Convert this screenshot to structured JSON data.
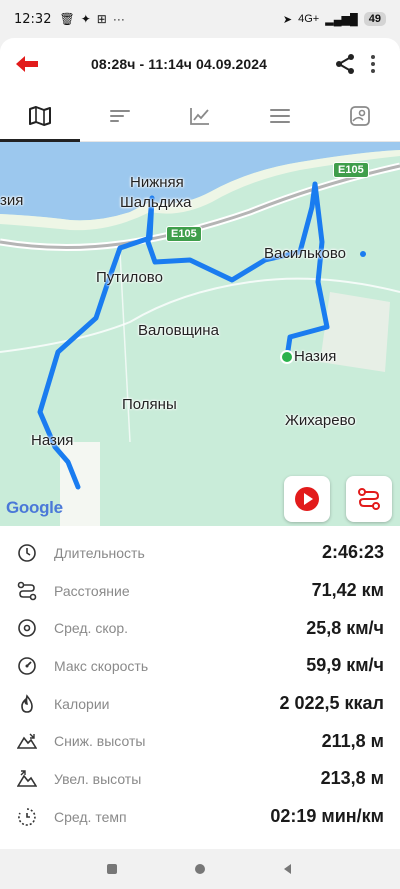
{
  "status_bar": {
    "time": "12:32",
    "network": "4G+",
    "battery": "49"
  },
  "header": {
    "title": "08:28ч - 11:14ч   04.09.2024"
  },
  "tabs": [
    {
      "icon": "map-icon",
      "active": true
    },
    {
      "icon": "laps-icon",
      "active": false
    },
    {
      "icon": "chart-icon",
      "active": false
    },
    {
      "icon": "list-icon",
      "active": false
    },
    {
      "icon": "photo-map-icon",
      "active": false
    }
  ],
  "map": {
    "labels": {
      "nizhnyaya": "Нижняя",
      "shaldikha": "Шальдиха",
      "putilovo": "Путилово",
      "valovshchina": "Валовщина",
      "polyany": "Поляны",
      "nazia_left": "Назия",
      "nazia_right": "Назия",
      "vasilkovo": "Васильково",
      "zhikharevo": "Жихарево",
      "edge_left": "зия"
    },
    "road_shields": [
      "E105",
      "E105"
    ],
    "attribution": "Google",
    "route_color": "#1a7cf0"
  },
  "stats": [
    {
      "icon": "duration-icon",
      "label": "Длительность",
      "value": "2:46:23"
    },
    {
      "icon": "distance-icon",
      "label": "Расстояние",
      "value": "71,42 км"
    },
    {
      "icon": "avg-speed-icon",
      "label": "Сред. скор.",
      "value": "25,8 км/ч"
    },
    {
      "icon": "max-speed-icon",
      "label": "Макс скорость",
      "value": "59,9 км/ч"
    },
    {
      "icon": "calories-icon",
      "label": "Калории",
      "value": "2 022,5 ккал"
    },
    {
      "icon": "descent-icon",
      "label": "Сниж. высоты",
      "value": "211,8 м"
    },
    {
      "icon": "ascent-icon",
      "label": "Увел. высоты",
      "value": "213,8 м"
    },
    {
      "icon": "pace-icon",
      "label": "Сред. темп",
      "value": "02:19 мин/км"
    }
  ],
  "colors": {
    "accent_red": "#e21b1b",
    "route_blue": "#1a7cf0",
    "map_green": "#c9ecd9",
    "water_blue": "#9cc8ee",
    "start_green": "#2bb24c"
  }
}
